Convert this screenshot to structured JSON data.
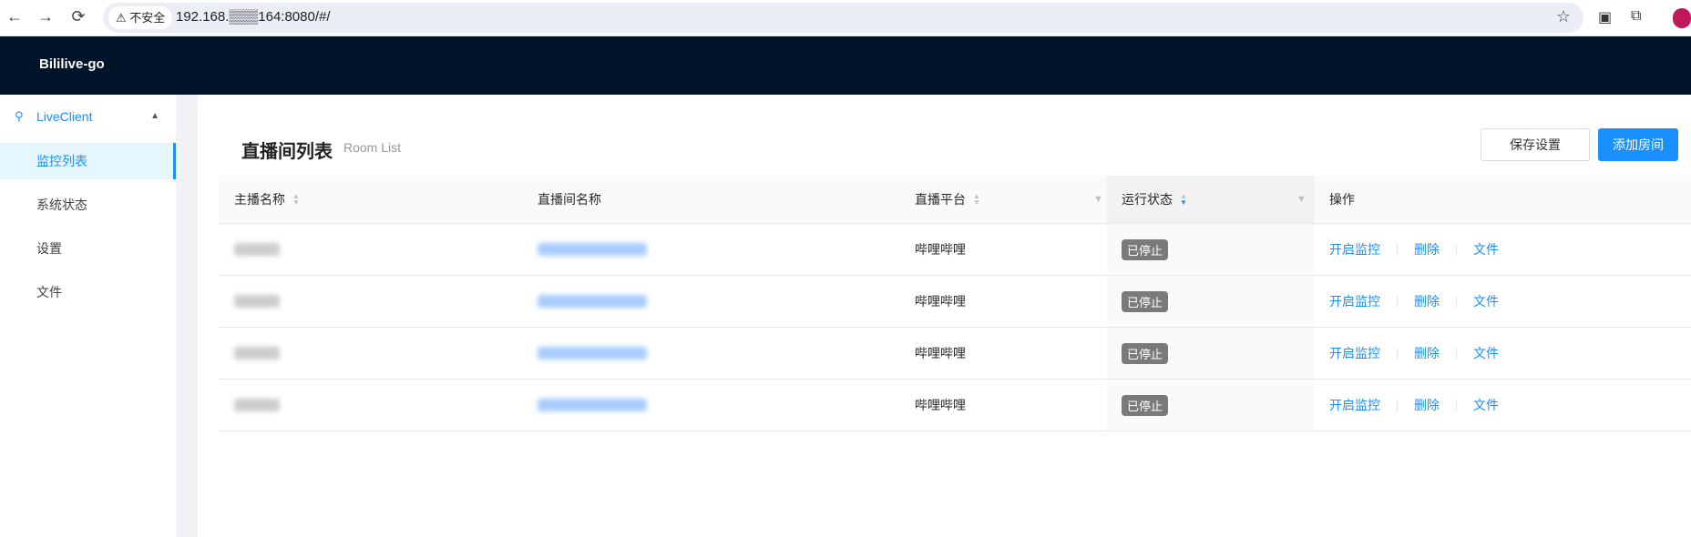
{
  "browser": {
    "back": "←",
    "forward": "→",
    "reload": "⟳",
    "security_label": "不安全",
    "url": "192.168.▒▒▒164:8080/#/"
  },
  "app": {
    "title": "Bililive-go"
  },
  "sidebar": {
    "group": "LiveClient",
    "items": [
      {
        "label": "监控列表",
        "selected": true
      },
      {
        "label": "系统状态"
      },
      {
        "label": "设置"
      },
      {
        "label": "文件"
      }
    ]
  },
  "page": {
    "title": "直播间列表",
    "subtitle": "Room List",
    "save_button": "保存设置",
    "add_button": "添加房间"
  },
  "table": {
    "columns": [
      "主播名称",
      "直播间名称",
      "直播平台",
      "运行状态",
      "操作"
    ],
    "rows": [
      {
        "platform": "哔哩哔哩",
        "status": "已停止"
      },
      {
        "platform": "哔哩哔哩",
        "status": "已停止"
      },
      {
        "platform": "哔哩哔哩",
        "status": "已停止"
      },
      {
        "platform": "哔哩哔哩",
        "status": "已停止"
      }
    ],
    "actions": {
      "start": "开启监控",
      "delete": "删除",
      "files": "文件"
    }
  },
  "colors": {
    "header": "#001529",
    "accent": "#1890ff",
    "tag": "#7a7a7a"
  }
}
